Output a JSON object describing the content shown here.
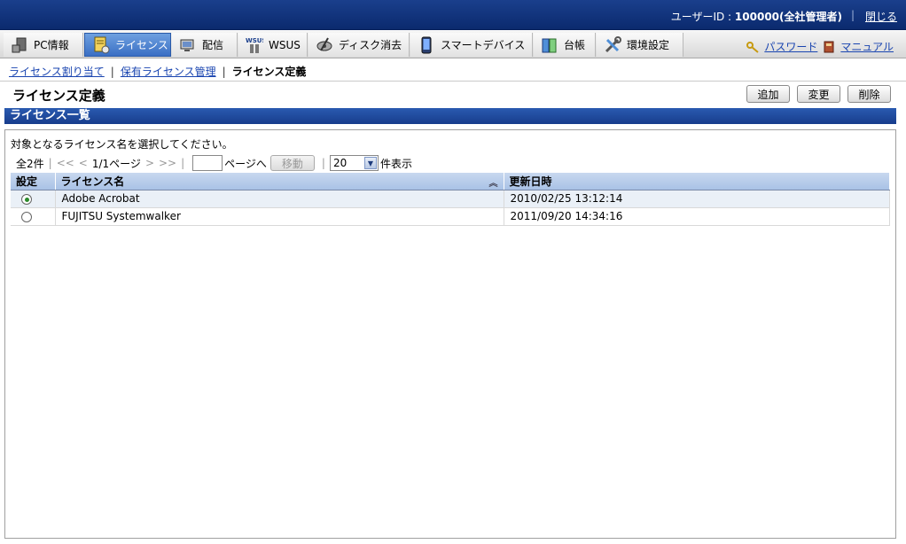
{
  "header": {
    "user_label": "ユーザーID : ",
    "user_value": "100000(全社管理者)",
    "close_label": "閉じる"
  },
  "nav": {
    "tabs": [
      {
        "label": "PC情報",
        "icon": "pc-info-icon"
      },
      {
        "label": "ライセンス",
        "icon": "license-icon",
        "active": true
      },
      {
        "label": "配信",
        "icon": "delivery-icon"
      },
      {
        "label": "WSUS",
        "icon": "wsus-icon"
      },
      {
        "label": "ディスク消去",
        "icon": "disk-erase-icon"
      },
      {
        "label": "スマートデバイス",
        "icon": "smart-device-icon"
      },
      {
        "label": "台帳",
        "icon": "ledger-icon"
      },
      {
        "label": "環境設定",
        "icon": "settings-icon"
      }
    ],
    "password_label": "パスワード",
    "manual_label": "マニュアル"
  },
  "breadcrumb": {
    "items": [
      "ライセンス割り当て",
      "保有ライセンス管理"
    ],
    "current": "ライセンス定義"
  },
  "page": {
    "title": "ライセンス定義",
    "add_label": "追加",
    "edit_label": "変更",
    "delete_label": "削除"
  },
  "section": {
    "title": "ライセンス一覧",
    "instruction": "対象となるライセンス名を選択してください。"
  },
  "pager": {
    "total": "全2件",
    "first": "<<",
    "prev": "<",
    "page_info": "1/1ページ",
    "next": ">",
    "last": ">>",
    "goto_suffix": "ページへ",
    "move_label": "移動",
    "per_page": "20",
    "per_page_suffix": "件表示"
  },
  "table": {
    "headers": [
      "設定",
      "ライセンス名",
      "更新日時"
    ],
    "rows": [
      {
        "selected": true,
        "name": "Adobe Acrobat",
        "updated": "2010/02/25 13:12:14"
      },
      {
        "selected": false,
        "name": "FUJITSU Systemwalker",
        "updated": "2011/09/20 14:34:16"
      }
    ]
  },
  "colors": {
    "header_bg": "#0b2a6e",
    "active_tab": "#3b6fc4",
    "section_header": "#173d8c",
    "link": "#1a45b0"
  }
}
